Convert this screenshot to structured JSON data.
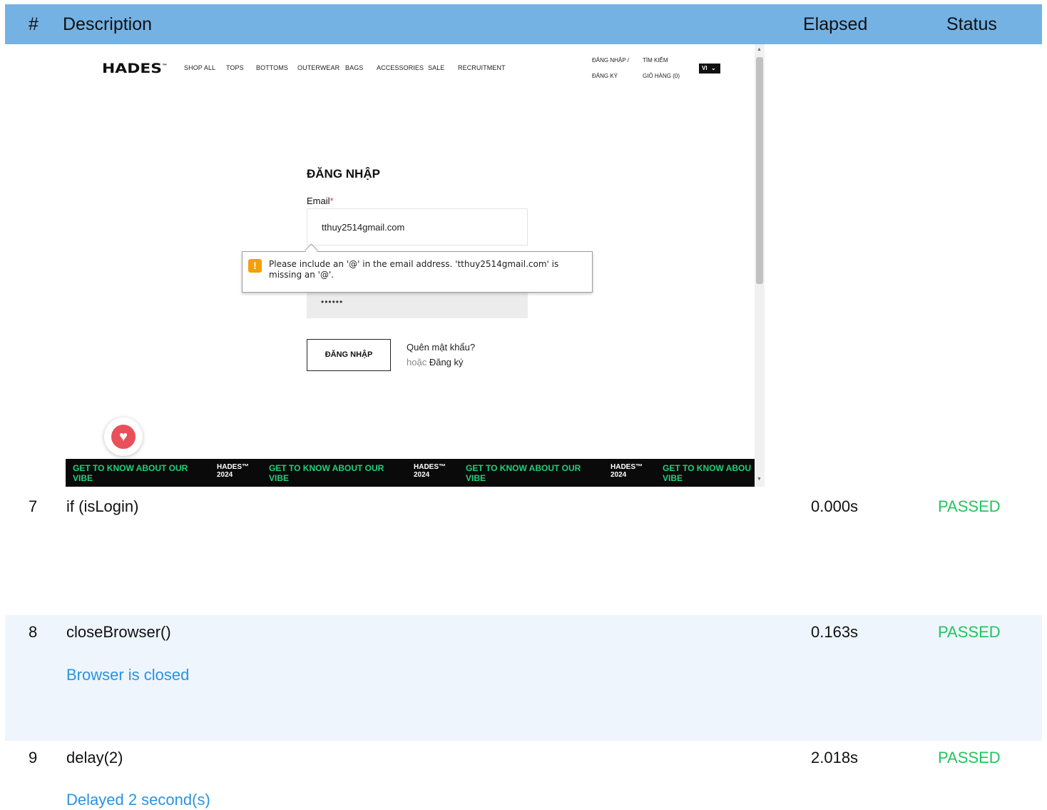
{
  "header": {
    "num": "#",
    "description": "Description",
    "elapsed": "Elapsed",
    "status": "Status"
  },
  "embedded": {
    "logo": "HADES",
    "logo_mark": "™",
    "nav": [
      "SHOP ALL",
      "TOPS",
      "BOTTOMS",
      "OUTERWEAR",
      "BAGS",
      "ACCESSORIES",
      "SALE",
      "RECRUITMENT"
    ],
    "account": {
      "login": "ĐĂNG NHẬP /",
      "register": "ĐĂNG KÝ",
      "search": "TÌM KIẾM",
      "cart": "GIỎ HÀNG (0)"
    },
    "lang": "VI",
    "lang_chevron": "chevron-down-icon",
    "form": {
      "title": "ĐĂNG NHẬP",
      "email_label": "Email",
      "required_mark": "*",
      "email_value": "tthuy2514gmail.com",
      "password_value": "••••••",
      "tooltip_icon": "!",
      "tooltip": "Please include an '@' in the email address. 'tthuy2514gmail.com' is missing an '@'.",
      "submit": "ĐĂNG NHẬP",
      "forgot": "Quên mật khẩu?",
      "or": "hoặc",
      "register": "Đăng ký"
    },
    "heart_icon": "heart-icon",
    "marquee": [
      {
        "vibe_1": "GET TO KNOW ABOUT OUR",
        "vibe_2": "VIBE",
        "brand": "HADES™",
        "year": "2024"
      },
      {
        "vibe_1": "GET TO KNOW ABOUT OUR",
        "vibe_2": "VIBE",
        "brand": "HADES™",
        "year": "2024"
      },
      {
        "vibe_1": "GET TO KNOW ABOUT OUR",
        "vibe_2": "VIBE",
        "brand": "HADES™",
        "year": "2024"
      },
      {
        "vibe_1": "GET TO KNOW ABOU",
        "vibe_2": "VIBE"
      }
    ]
  },
  "rows": [
    {
      "num": "7",
      "description": "if (isLogin)",
      "elapsed": "0.000s",
      "status": "PASSED"
    },
    {
      "num": "8",
      "description": "closeBrowser()",
      "elapsed": "0.163s",
      "status": "PASSED",
      "log": "Browser is closed"
    },
    {
      "num": "9",
      "description": "delay(2)",
      "elapsed": "2.018s",
      "status": "PASSED",
      "log": "Delayed 2 second(s)"
    }
  ],
  "colors": {
    "header_bg": "#74b2e4",
    "passed": "#22c55e",
    "log": "#2a93e0",
    "band": "#eef5fd",
    "vibe": "#1fd17a"
  }
}
